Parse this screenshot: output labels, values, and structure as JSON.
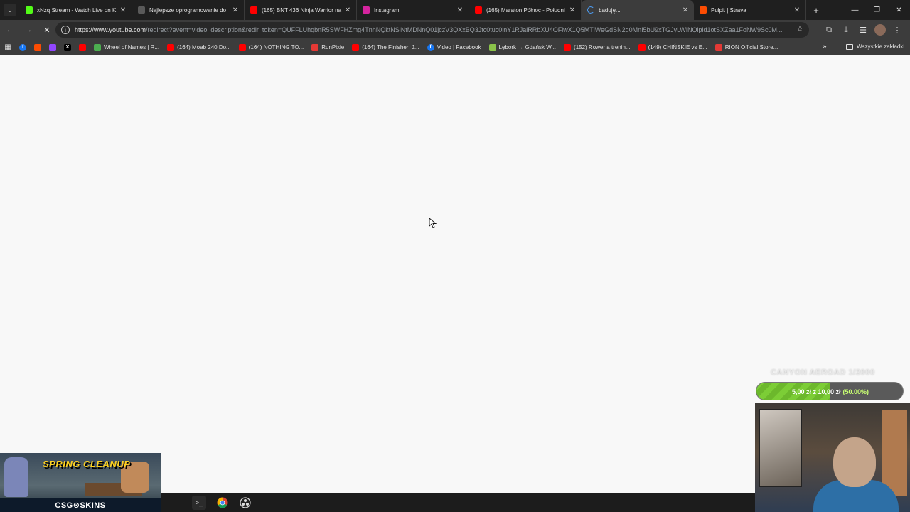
{
  "tabs": [
    {
      "title": "xNzq Stream - Watch Live on K",
      "icon": "kick-icon",
      "color": "#53fc18",
      "active": false
    },
    {
      "title": "Najlepsze oprogramowanie do",
      "icon": "shield-icon",
      "color": "#5a5a5a",
      "active": false
    },
    {
      "title": "(165) BNT 436 Ninja Warrior na",
      "icon": "youtube-icon",
      "color": "#ff0000",
      "active": false
    },
    {
      "title": "Instagram",
      "icon": "instagram-icon",
      "color": "#d6249f",
      "active": false
    },
    {
      "title": "(165) Maraton Północ - Południ",
      "icon": "youtube-icon",
      "color": "#ff0000",
      "active": false
    },
    {
      "title": "Ładuję...",
      "icon": "loading-spinner",
      "color": "#4da3ff",
      "active": true
    },
    {
      "title": "Pulpit | Strava",
      "icon": "strava-icon",
      "color": "#fc4c02",
      "active": false
    }
  ],
  "address": {
    "url_host": "https://www.youtube.com",
    "url_rest": "/redirect?event=video_description&redir_token=QUFFLUhqbnR5SWFHZmg4TnhNQktNSlNtMDNnQ01jczV3QXxBQ3Jtc0tuc0lnY1RJalRRbXU4OFlwX1Q5MTlWeGdSN2g0MnI5bU9xTGJyLWlNQlpld1otSXZaa1FoNW9Sc0M..."
  },
  "bookmarks": [
    {
      "label": "",
      "icon": "apps-icon",
      "color": "#3c3c3c"
    },
    {
      "label": "",
      "icon": "facebook-icon",
      "color": "#1877f2"
    },
    {
      "label": "",
      "icon": "strava-icon",
      "color": "#fc4c02"
    },
    {
      "label": "",
      "icon": "twitch-icon",
      "color": "#9146ff"
    },
    {
      "label": "",
      "icon": "x-icon",
      "color": "#000000"
    },
    {
      "label": "",
      "icon": "youtube-icon",
      "color": "#ff0000"
    },
    {
      "label": "Wheel of Names | R...",
      "icon": "wheel-icon",
      "color": "#4caf50"
    },
    {
      "label": "(164) Moab 240 Do...",
      "icon": "youtube-icon",
      "color": "#ff0000"
    },
    {
      "label": "(164) NOTHING TO...",
      "icon": "youtube-icon",
      "color": "#ff0000"
    },
    {
      "label": "RunPixie",
      "icon": "runpixie-icon",
      "color": "#e53935"
    },
    {
      "label": "(164) The Finisher: J...",
      "icon": "youtube-icon",
      "color": "#ff0000"
    },
    {
      "label": "Video | Facebook",
      "icon": "facebook-icon",
      "color": "#1877f2"
    },
    {
      "label": "Lębork → Gdańsk W...",
      "icon": "maps-icon",
      "color": "#8bc34a"
    },
    {
      "label": "(152) Rower a trenin...",
      "icon": "youtube-icon",
      "color": "#ff0000"
    },
    {
      "label": "(149) CHIŃSKIE vs E...",
      "icon": "youtube-icon",
      "color": "#ff0000"
    },
    {
      "label": "RION Official Store...",
      "icon": "store-icon",
      "color": "#e53935"
    }
  ],
  "bookmarks_folder": "Wszystkie zakładki",
  "goal": {
    "title": "CANYON AEROAD 1/2000",
    "current": "5,00 zł",
    "separator": "z",
    "target": "10,00 zł",
    "percent_label": "(50.00%)",
    "progress": 0.5
  },
  "ad": {
    "title": "SPRING CLEANUP",
    "brand": "CSG⊙SKINS"
  },
  "taskbar": [
    {
      "icon": "terminal-icon"
    },
    {
      "icon": "chrome-icon"
    },
    {
      "icon": "obs-icon"
    }
  ]
}
